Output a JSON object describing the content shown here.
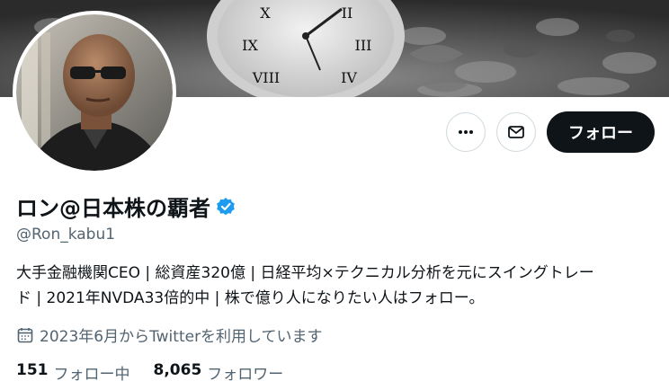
{
  "profile": {
    "display_name": "ロン@日本株の覇者",
    "handle": "@Ron_kabu1",
    "bio_line1": "大手金融機関CEO | 総資産320億 | 日経平均×テクニカル分析を元にスイングトレー",
    "bio_line2": "ド | 2021年NVDA33倍的中 | 株で億り人になりたい人はフォロー。",
    "joined": "2023年6月からTwitterを利用しています",
    "verified_color": "#1d9bf0"
  },
  "actions": {
    "more_icon": "more-horizontal-icon",
    "message_icon": "mail-icon",
    "follow_label": "フォロー"
  },
  "stats": {
    "following_count": "151",
    "following_label": "フォロー中",
    "followers_count": "8,065",
    "followers_label": "フォロワー"
  },
  "colors": {
    "text_primary": "#0f1419",
    "text_secondary": "#536471",
    "follow_button_bg": "#0f1419",
    "border": "#cfd9de"
  }
}
